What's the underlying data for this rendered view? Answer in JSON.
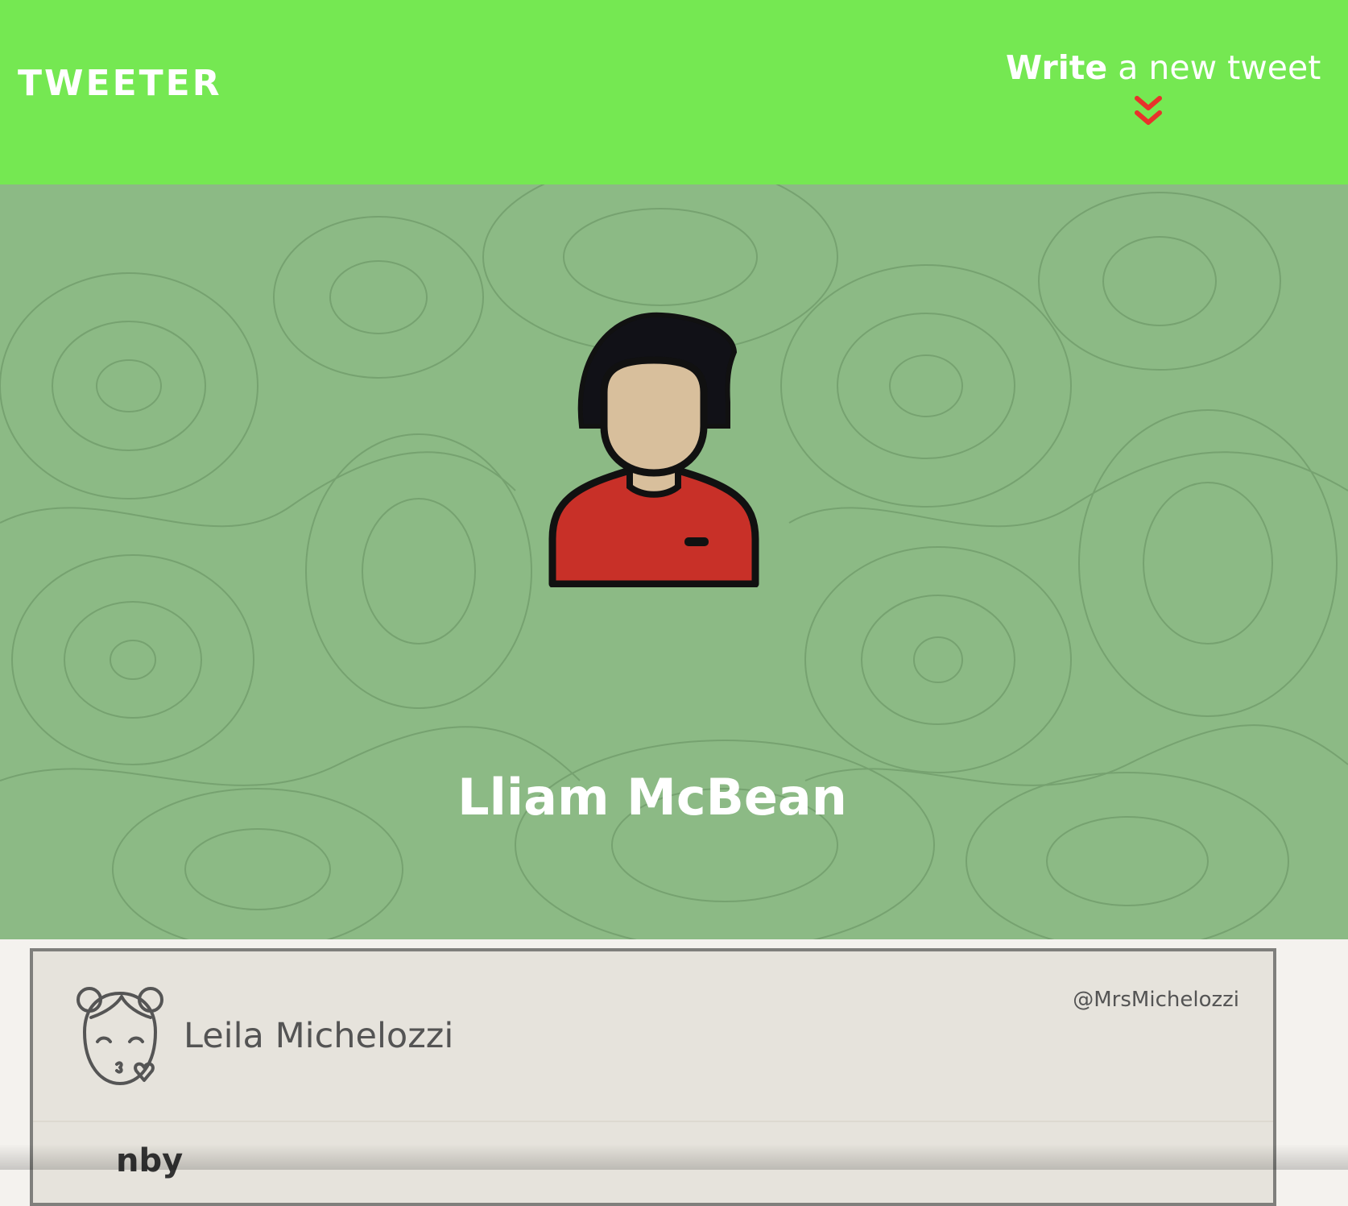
{
  "header": {
    "logo": "TWEETER",
    "compose_strong": "Write",
    "compose_rest": " a new tweet",
    "compose_icon": "double-chevron-down-icon",
    "accent_color": "#75e852",
    "chevron_color": "#e8322b"
  },
  "profile": {
    "name": "Lliam McBean",
    "avatar_icon": "user-avatar-icon",
    "banner_color": "#8cba85"
  },
  "tweets": [
    {
      "author_name": "Leila Michelozzi",
      "handle": "@MrsMichelozzi",
      "avatar_icon": "kissing-girl-avatar-icon",
      "content": "nby"
    }
  ]
}
